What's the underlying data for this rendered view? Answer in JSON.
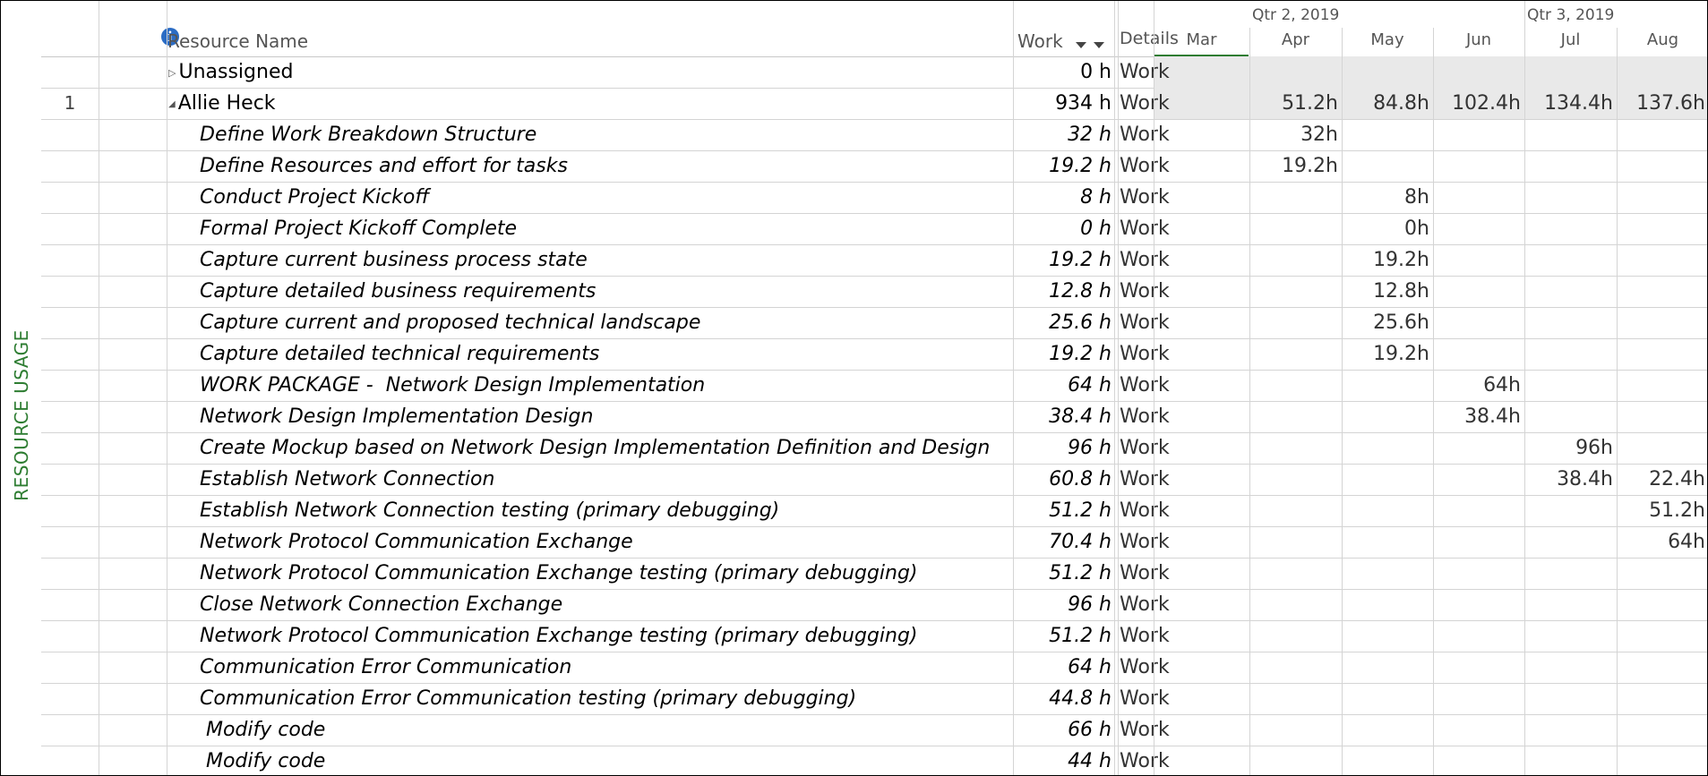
{
  "side_label": "RESOURCE USAGE",
  "columns": {
    "name": "Resource Name",
    "work": "Work",
    "details": "Details"
  },
  "timescale": {
    "quarters": [
      "Qtr 2, 2019",
      "Qtr 3, 2019"
    ],
    "months": [
      "Mar",
      "Apr",
      "May",
      "Jun",
      "Jul",
      "Aug"
    ]
  },
  "rows": [
    {
      "id": "",
      "name": "Unassigned",
      "work": "0 h",
      "detail": "Work",
      "kind": "group-collapsed",
      "tl": [
        "",
        "",
        "",
        "",
        "",
        ""
      ]
    },
    {
      "id": "1",
      "name": "Allie Heck",
      "work": "934 h",
      "detail": "Work",
      "kind": "group-open",
      "tl": [
        "",
        "51.2h",
        "84.8h",
        "102.4h",
        "134.4h",
        "137.6h"
      ]
    },
    {
      "id": "",
      "name": "Define Work Breakdown Structure",
      "work": "32 h",
      "detail": "Work",
      "kind": "task",
      "tl": [
        "",
        "32h",
        "",
        "",
        "",
        ""
      ]
    },
    {
      "id": "",
      "name": "Define Resources and effort for tasks",
      "work": "19.2 h",
      "detail": "Work",
      "kind": "task",
      "tl": [
        "",
        "19.2h",
        "",
        "",
        "",
        ""
      ]
    },
    {
      "id": "",
      "name": "Conduct Project Kickoff",
      "work": "8 h",
      "detail": "Work",
      "kind": "task",
      "tl": [
        "",
        "",
        "8h",
        "",
        "",
        ""
      ]
    },
    {
      "id": "",
      "name": "Formal Project Kickoff Complete",
      "work": "0 h",
      "detail": "Work",
      "kind": "task",
      "tl": [
        "",
        "",
        "0h",
        "",
        "",
        ""
      ]
    },
    {
      "id": "",
      "name": "Capture current business process state",
      "work": "19.2 h",
      "detail": "Work",
      "kind": "task",
      "tl": [
        "",
        "",
        "19.2h",
        "",
        "",
        ""
      ]
    },
    {
      "id": "",
      "name": "Capture detailed business requirements",
      "work": "12.8 h",
      "detail": "Work",
      "kind": "task",
      "tl": [
        "",
        "",
        "12.8h",
        "",
        "",
        ""
      ]
    },
    {
      "id": "",
      "name": "Capture current and proposed technical landscape",
      "work": "25.6 h",
      "detail": "Work",
      "kind": "task",
      "tl": [
        "",
        "",
        "25.6h",
        "",
        "",
        ""
      ]
    },
    {
      "id": "",
      "name": "Capture detailed technical requirements",
      "work": "19.2 h",
      "detail": "Work",
      "kind": "task",
      "tl": [
        "",
        "",
        "19.2h",
        "",
        "",
        ""
      ]
    },
    {
      "id": "",
      "name": "WORK PACKAGE -  Network Design Implementation",
      "work": "64 h",
      "detail": "Work",
      "kind": "task",
      "tl": [
        "",
        "",
        "",
        "64h",
        "",
        ""
      ]
    },
    {
      "id": "",
      "name": "Network Design Implementation Design",
      "work": "38.4 h",
      "detail": "Work",
      "kind": "task",
      "tl": [
        "",
        "",
        "",
        "38.4h",
        "",
        ""
      ]
    },
    {
      "id": "",
      "name": "Create Mockup based on Network Design Implementation Definition and Design",
      "work": "96 h",
      "detail": "Work",
      "kind": "task",
      "tl": [
        "",
        "",
        "",
        "",
        "96h",
        ""
      ]
    },
    {
      "id": "",
      "name": "Establish Network Connection",
      "work": "60.8 h",
      "detail": "Work",
      "kind": "task",
      "tl": [
        "",
        "",
        "",
        "",
        "38.4h",
        "22.4h"
      ]
    },
    {
      "id": "",
      "name": "Establish Network Connection testing (primary debugging)",
      "work": "51.2 h",
      "detail": "Work",
      "kind": "task",
      "tl": [
        "",
        "",
        "",
        "",
        "",
        "51.2h"
      ]
    },
    {
      "id": "",
      "name": "Network Protocol Communication Exchange",
      "work": "70.4 h",
      "detail": "Work",
      "kind": "task",
      "tl": [
        "",
        "",
        "",
        "",
        "",
        "64h"
      ]
    },
    {
      "id": "",
      "name": "Network Protocol Communication Exchange testing (primary debugging)",
      "work": "51.2 h",
      "detail": "Work",
      "kind": "task",
      "tl": [
        "",
        "",
        "",
        "",
        "",
        ""
      ]
    },
    {
      "id": "",
      "name": "Close Network Connection Exchange",
      "work": "96 h",
      "detail": "Work",
      "kind": "task",
      "tl": [
        "",
        "",
        "",
        "",
        "",
        ""
      ]
    },
    {
      "id": "",
      "name": "Network Protocol Communication Exchange testing (primary debugging)",
      "work": "51.2 h",
      "detail": "Work",
      "kind": "task",
      "tl": [
        "",
        "",
        "",
        "",
        "",
        ""
      ]
    },
    {
      "id": "",
      "name": "Communication Error Communication",
      "work": "64 h",
      "detail": "Work",
      "kind": "task",
      "tl": [
        "",
        "",
        "",
        "",
        "",
        ""
      ]
    },
    {
      "id": "",
      "name": "Communication Error Communication testing (primary debugging)",
      "work": "44.8 h",
      "detail": "Work",
      "kind": "task",
      "tl": [
        "",
        "",
        "",
        "",
        "",
        ""
      ]
    },
    {
      "id": "",
      "name": " Modify code",
      "work": "66 h",
      "detail": "Work",
      "kind": "task",
      "tl": [
        "",
        "",
        "",
        "",
        "",
        ""
      ]
    },
    {
      "id": "",
      "name": " Modify code",
      "work": "44 h",
      "detail": "Work",
      "kind": "task",
      "tl": [
        "",
        "",
        "",
        "",
        "",
        ""
      ]
    }
  ]
}
